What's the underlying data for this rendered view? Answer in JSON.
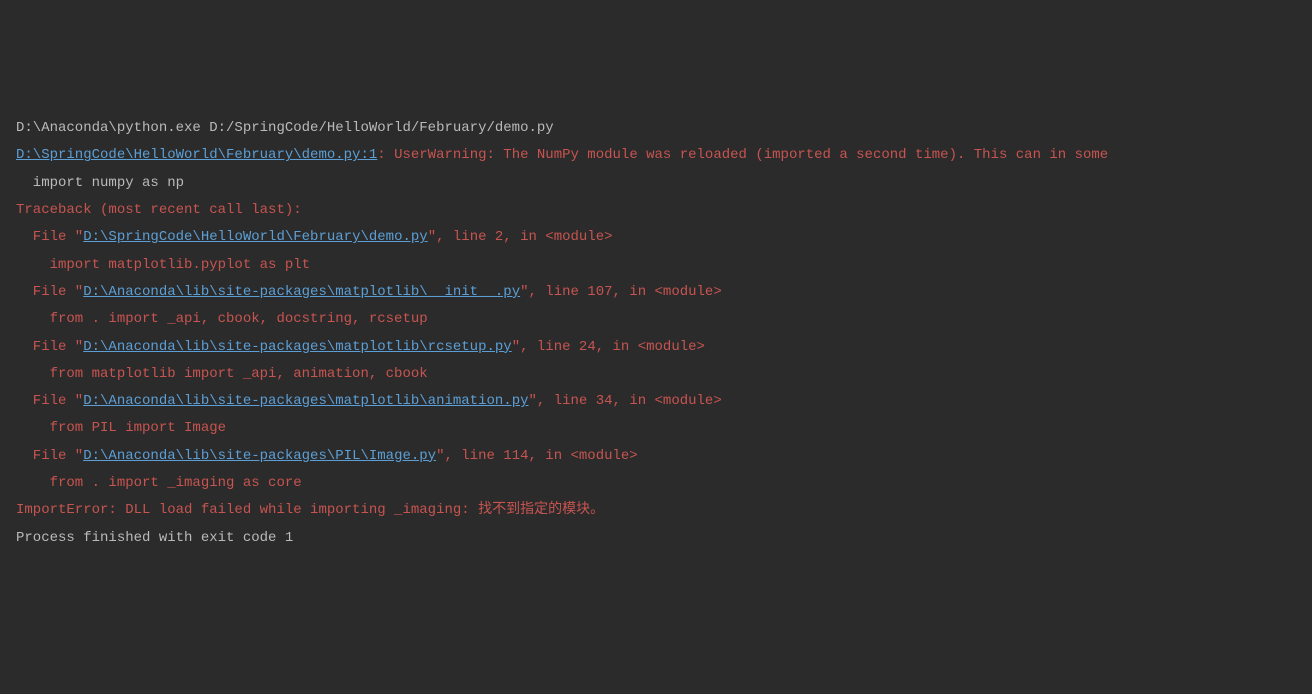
{
  "command": "D:\\Anaconda\\python.exe D:/SpringCode/HelloWorld/February/demo.py",
  "warning": {
    "link": "D:\\SpringCode\\HelloWorld\\February\\demo.py:1",
    "colon": ": ",
    "text": "UserWarning: The NumPy module was reloaded (imported a second time). This can in some",
    "code": "  import numpy as np"
  },
  "traceback_header": "Traceback (most recent call last):",
  "frames": [
    {
      "file_prefix": "  File \"",
      "file_link": "D:\\SpringCode\\HelloWorld\\February\\demo.py",
      "file_suffix": "\", line 2, in <module>",
      "code": "    import matplotlib.pyplot as plt"
    },
    {
      "file_prefix": "  File \"",
      "file_link": "D:\\Anaconda\\lib\\site-packages\\matplotlib\\__init__.py",
      "file_suffix": "\", line 107, in <module>",
      "code": "    from . import _api, cbook, docstring, rcsetup"
    },
    {
      "file_prefix": "  File \"",
      "file_link": "D:\\Anaconda\\lib\\site-packages\\matplotlib\\rcsetup.py",
      "file_suffix": "\", line 24, in <module>",
      "code": "    from matplotlib import _api, animation, cbook"
    },
    {
      "file_prefix": "  File \"",
      "file_link": "D:\\Anaconda\\lib\\site-packages\\matplotlib\\animation.py",
      "file_suffix": "\", line 34, in <module>",
      "code": "    from PIL import Image"
    },
    {
      "file_prefix": "  File \"",
      "file_link": "D:\\Anaconda\\lib\\site-packages\\PIL\\Image.py",
      "file_suffix": "\", line 114, in <module>",
      "code": "    from . import _imaging as core"
    }
  ],
  "error": "ImportError: DLL load failed while importing _imaging: 找不到指定的模块。",
  "blank": "",
  "process": "Process finished with exit code 1"
}
